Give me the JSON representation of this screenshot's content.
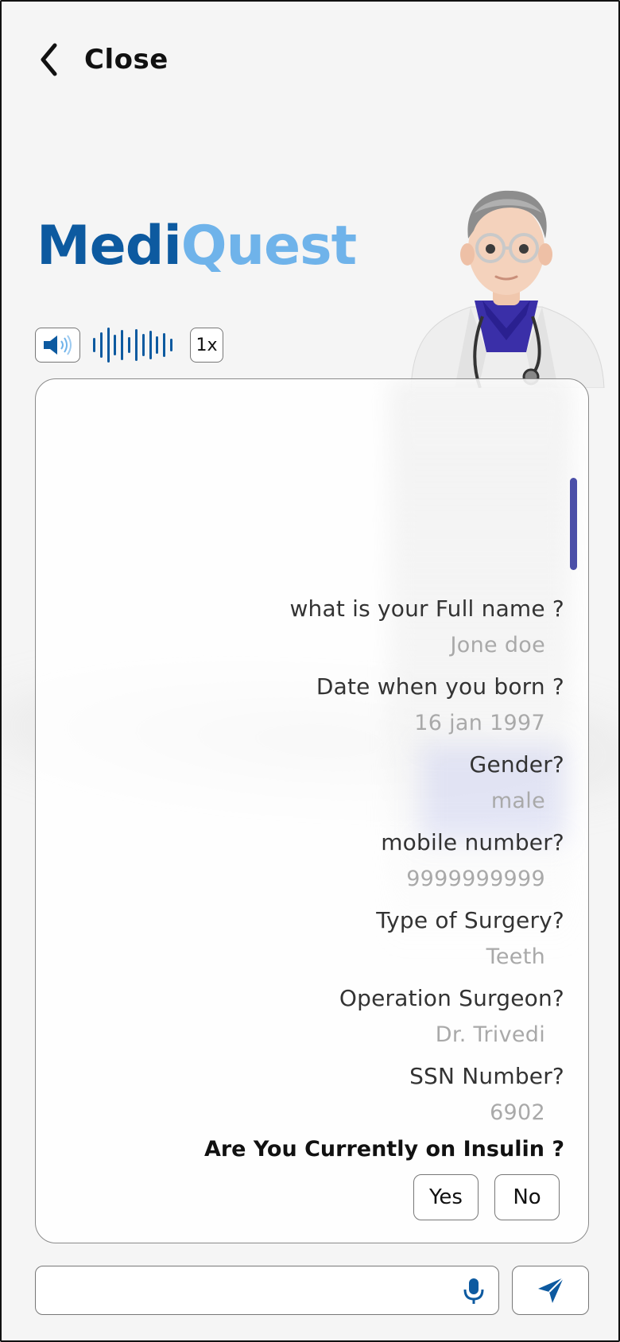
{
  "header": {
    "back_label": "Close"
  },
  "brand": {
    "part1": "Medi",
    "part2": "Quest",
    "color_primary": "#0d5aa0",
    "color_secondary": "#6fb3ea"
  },
  "audio": {
    "speaker_icon": "speaker-icon",
    "speed_label": "1x"
  },
  "chat": {
    "items": [
      {
        "question": "what is your Full name ?",
        "answer": "Jone doe"
      },
      {
        "question": "Date when you born ?",
        "answer": "16 jan 1997"
      },
      {
        "question": "Gender?",
        "answer": "male"
      },
      {
        "question": "mobile number?",
        "answer": "9999999999"
      },
      {
        "question": "Type of Surgery?",
        "answer": "Teeth"
      },
      {
        "question": "Operation Surgeon?",
        "answer": "Dr. Trivedi"
      },
      {
        "question": "SSN Number?",
        "answer": "6902"
      }
    ],
    "current_question": "Are You Currently on Insulin ?",
    "options": {
      "yes": "Yes",
      "no": "No"
    }
  },
  "composer": {
    "value": "",
    "mic_icon": "microphone-icon",
    "send_icon": "send-icon"
  }
}
